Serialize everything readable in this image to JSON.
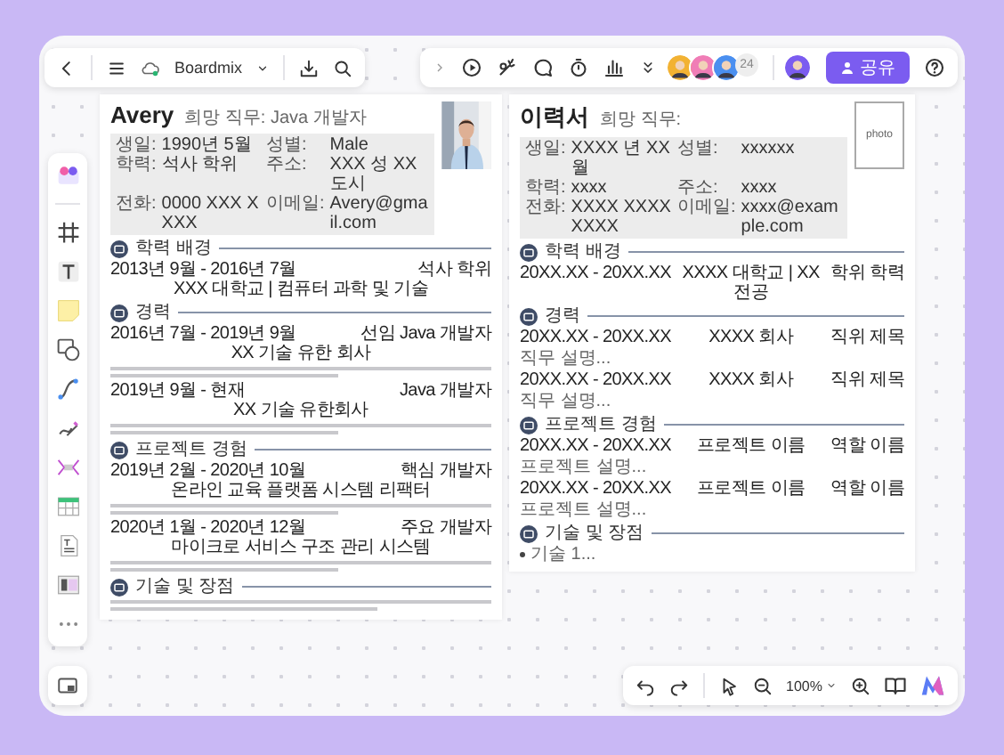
{
  "topbar": {
    "app_name": "Boardmix",
    "avatar_count": "24",
    "share_label": "공유"
  },
  "zoom": {
    "value": "100%"
  },
  "documents": [
    {
      "name": "Avery",
      "target": "희망 직무: Java 개발자",
      "info": [
        {
          "label": "생일:",
          "value": "1990년 5월"
        },
        {
          "label": "성별:",
          "value": "Male"
        },
        {
          "label": "학력:",
          "value": "석사 학위"
        },
        {
          "label": "주소:",
          "value": "XXX 성 XX 도시"
        },
        {
          "label": "전화:",
          "value": "0000 XXX XXXX"
        },
        {
          "label": "이메일:",
          "value": "Avery@gmail.com"
        }
      ],
      "sections": [
        {
          "title": "학력 배경",
          "items": [
            {
              "kind": "entry",
              "date": "2013년 9월 - 2016년 7월",
              "org": "XXX 대학교 | 컴퓨터 과학 및 기술",
              "role": "석사 학위"
            }
          ]
        },
        {
          "title": "경력",
          "items": [
            {
              "kind": "entry",
              "date": "2016년 7월 - 2019년 9월",
              "org": "XX 기술 유한 회사",
              "role": "선임 Java 개발자"
            },
            {
              "kind": "paragraph"
            },
            {
              "kind": "entry",
              "date": "2019년 9월 - 현재",
              "org": "XX 기술 유한회사",
              "role": "Java 개발자"
            },
            {
              "kind": "paragraph"
            }
          ]
        },
        {
          "title": "프로젝트 경험",
          "items": [
            {
              "kind": "entry",
              "date": "2019년 2월 - 2020년 10월",
              "org": "온라인 교육 플랫폼 시스템 리팩터",
              "role": "핵심 개발자"
            },
            {
              "kind": "paragraph"
            },
            {
              "kind": "entry",
              "date": "2020년 1월 - 2020년 12월",
              "org": "마이크로 서비스 구조 관리 시스템",
              "role": "주요 개발자"
            },
            {
              "kind": "paragraph"
            }
          ]
        },
        {
          "title": "기술 및 장점",
          "items": [
            {
              "kind": "bullet"
            }
          ]
        }
      ]
    },
    {
      "name": "이력서",
      "target": "희망 직무:",
      "photo": {
        "kind": "placeholder",
        "label": "photo"
      },
      "info": [
        {
          "label": "생일:",
          "value": "XXXX 년 XX 월"
        },
        {
          "label": "성별:",
          "value": "xxxxxx"
        },
        {
          "label": "학력:",
          "value": "xxxx"
        },
        {
          "label": "주소:",
          "value": "xxxx"
        },
        {
          "label": "전화:",
          "value": "XXXX XXXX XXXX"
        },
        {
          "label": "이메일:",
          "value": "xxxx@example.com"
        }
      ],
      "sections": [
        {
          "title": "학력 배경",
          "items": [
            {
              "kind": "entry",
              "date": "20XX.XX - 20XX.XX",
              "org": "XXXX 대학교 | XX 전공",
              "role": "학위 학력"
            }
          ]
        },
        {
          "title": "경력",
          "items": [
            {
              "kind": "entry",
              "date": "20XX.XX - 20XX.XX",
              "org": "XXXX 회사",
              "role": "직위 제목"
            },
            {
              "kind": "text",
              "text": "직무 설명..."
            },
            {
              "kind": "entry",
              "date": "20XX.XX - 20XX.XX",
              "org": "XXXX 회사",
              "role": "직위 제목"
            },
            {
              "kind": "text",
              "text": "직무 설명..."
            }
          ]
        },
        {
          "title": "프로젝트 경험",
          "items": [
            {
              "kind": "entry",
              "date": "20XX.XX - 20XX.XX",
              "org": "프로젝트 이름",
              "role": "역할 이름"
            },
            {
              "kind": "text",
              "text": "프로젝트 설명..."
            },
            {
              "kind": "entry",
              "date": "20XX.XX - 20XX.XX",
              "org": "프로젝트 이름",
              "role": "역할 이름"
            },
            {
              "kind": "text",
              "text": "프로젝트 설명..."
            }
          ]
        },
        {
          "title": "기술 및 장점",
          "items": [
            {
              "kind": "bullet_text",
              "text": "기술 1..."
            }
          ]
        }
      ]
    }
  ]
}
